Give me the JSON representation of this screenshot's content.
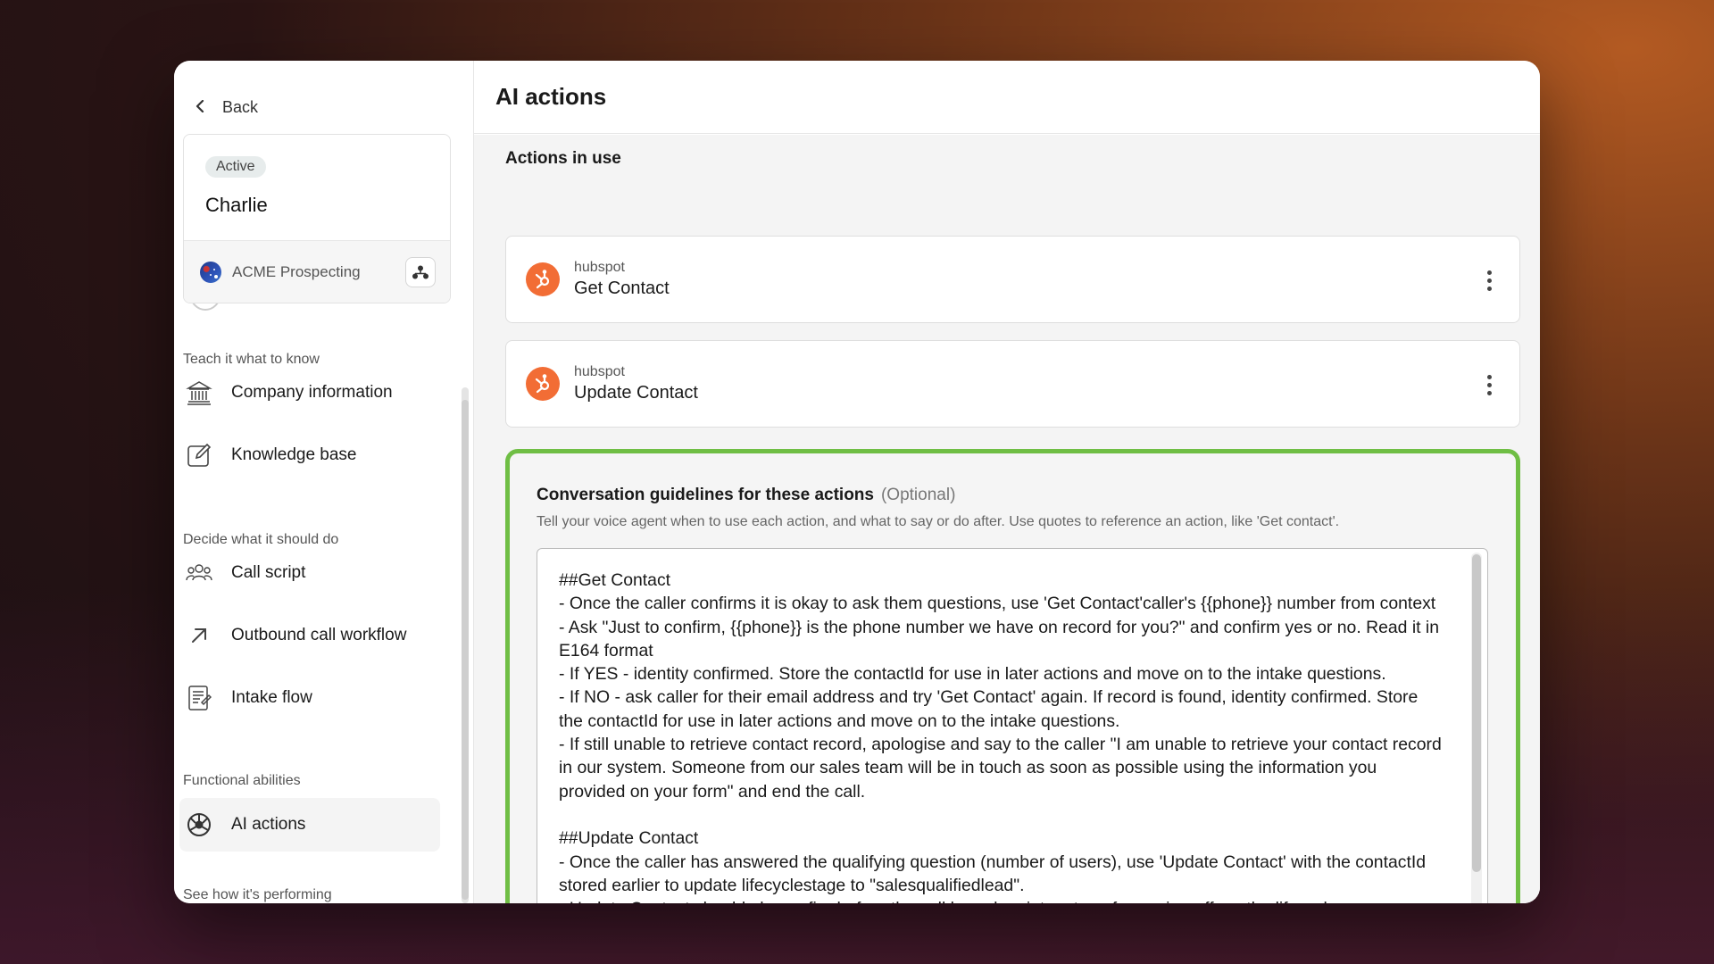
{
  "sidebar": {
    "back_label": "Back",
    "agent": {
      "status": "Active",
      "name": "Charlie",
      "workspace": "ACME Prospecting"
    },
    "sections": [
      {
        "label": "Teach it what to know",
        "items": [
          {
            "label": "Company information",
            "icon": "bank-icon"
          },
          {
            "label": "Knowledge base",
            "icon": "edit-icon"
          }
        ]
      },
      {
        "label": "Decide what it should do",
        "items": [
          {
            "label": "Call script",
            "icon": "people-icon"
          },
          {
            "label": "Outbound call workflow",
            "icon": "arrow-up-right-icon"
          },
          {
            "label": "Intake flow",
            "icon": "form-icon"
          }
        ]
      },
      {
        "label": "Functional abilities",
        "items": [
          {
            "label": "AI actions",
            "icon": "ai-actions-icon",
            "active": true
          }
        ]
      },
      {
        "label": "See how it's performing",
        "items": []
      }
    ]
  },
  "main": {
    "title": "AI actions",
    "actions_heading": "Actions in use",
    "actions": [
      {
        "provider": "hubspot",
        "name": "Get Contact"
      },
      {
        "provider": "hubspot",
        "name": "Update Contact"
      }
    ],
    "guidelines": {
      "title": "Conversation guidelines for these actions",
      "optional": "(Optional)",
      "help": "Tell your voice agent when to use each action, and what to say or do after. Use quotes to reference an action, like 'Get contact'.",
      "text": "##Get Contact\n- Once the caller confirms it is okay to ask them questions, use 'Get Contact'caller's {{phone}} number from context\n- Ask \"Just to confirm, {{phone}} is the phone number we have on record for you?\" and confirm yes or no. Read it in E164 format\n- If YES - identity confirmed. Store the contactId for use in later actions and move on to the intake questions.\n- If NO - ask caller for their email address and try 'Get Contact' again. If record is found, identity confirmed. Store the contactId for use in later actions and move on to the intake questions.\n- If still unable to retrieve contact record, apologise and say to the caller \"I am unable to retrieve your contact record in our system. Someone from our sales team will be in touch as soon as possible using the information you provided on your form\" and end the call.\n\n##Update Contact\n- Once the caller has answered the qualifying question (number of users), use 'Update Contact' with the contactId stored earlier to update lifecyclestage to \"salesqualifiedlead\".\n- Update Contact should always fire before the call branches into a transfer or sign-off, so the lifecycle"
    }
  },
  "colors": {
    "accent_green": "#6fbe44",
    "hubspot_orange": "#f26d35"
  }
}
